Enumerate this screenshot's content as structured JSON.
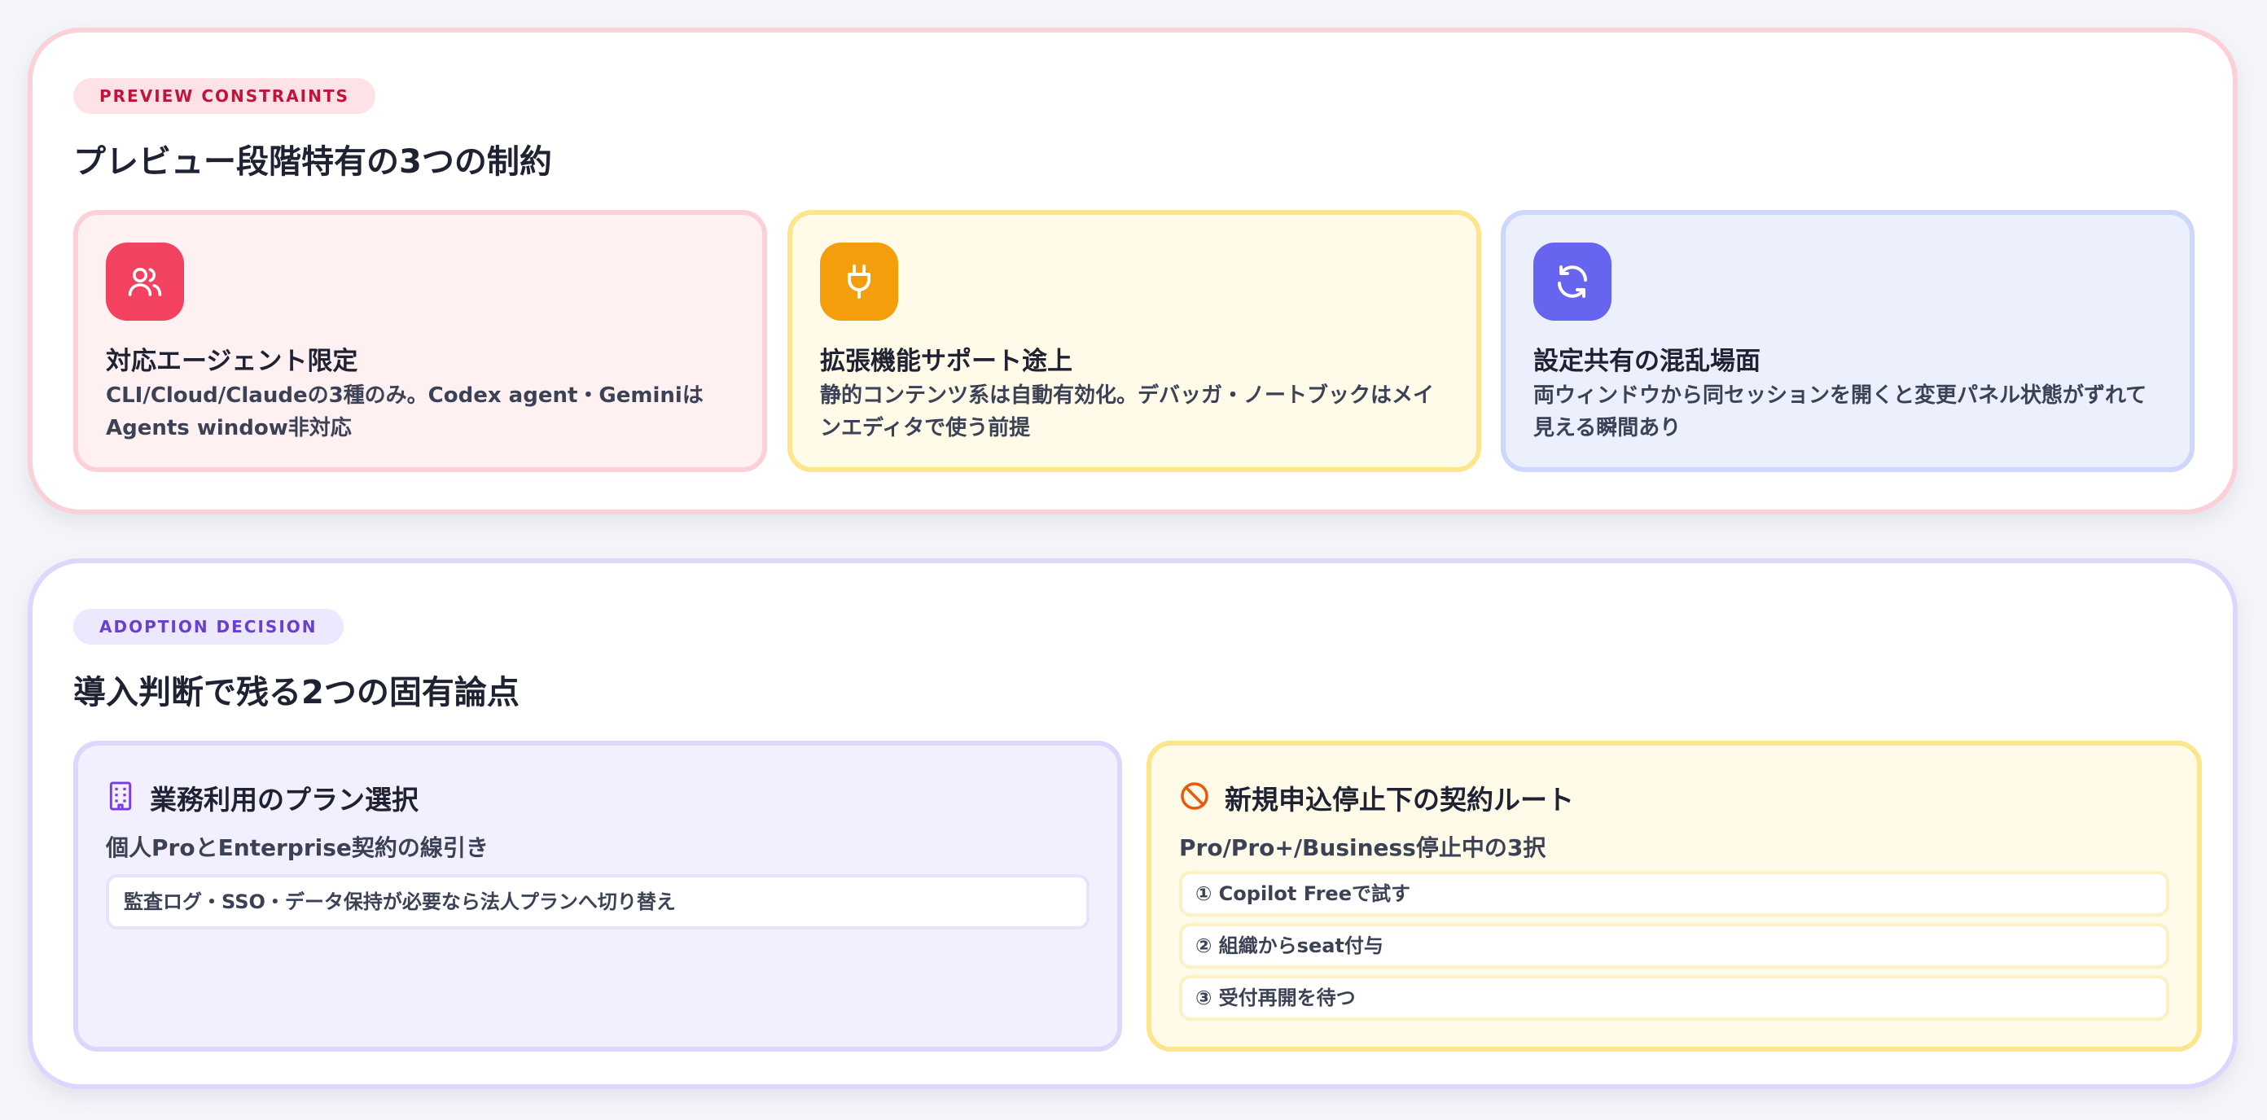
{
  "constraints": {
    "badge": "PREVIEW CONSTRAINTS",
    "title": "プレビュー段階特有の3つの制約",
    "cards": [
      {
        "icon": "users-icon",
        "color": "#f2425f",
        "title": "対応エージェント限定",
        "desc": "CLI/Cloud/Claudeの3種のみ。Codex agent・GeminiはAgents window非対応"
      },
      {
        "icon": "plug-icon",
        "color": "#f59e0b",
        "title": "拡張機能サポート途上",
        "desc": "静的コンテンツ系は自動有効化。デバッガ・ノートブックはメインエディタで使う前提"
      },
      {
        "icon": "refresh-icon",
        "color": "#6764f0",
        "title": "設定共有の混乱場面",
        "desc": "両ウィンドウから同セッションを開くと変更パネル状態がずれて見える瞬間あり"
      }
    ]
  },
  "adoption": {
    "badge": "ADOPTION DECISION",
    "title": "導入判断で残る2つの固有論点",
    "plan": {
      "icon": "building-icon",
      "title": "業務利用のプラン選択",
      "subtitle": "個人ProとEnterprise契約の線引き",
      "note": "監査ログ・SSO・データ保持が必要なら法人プランへ切り替え"
    },
    "route": {
      "icon": "prohibited-icon",
      "title": "新規申込停止下の契約ルート",
      "subtitle": "Pro/Pro+/Business停止中の3択",
      "options": [
        "① Copilot Freeで試す",
        "② 組織からseat付与",
        "③ 受付再開を待つ"
      ]
    }
  }
}
